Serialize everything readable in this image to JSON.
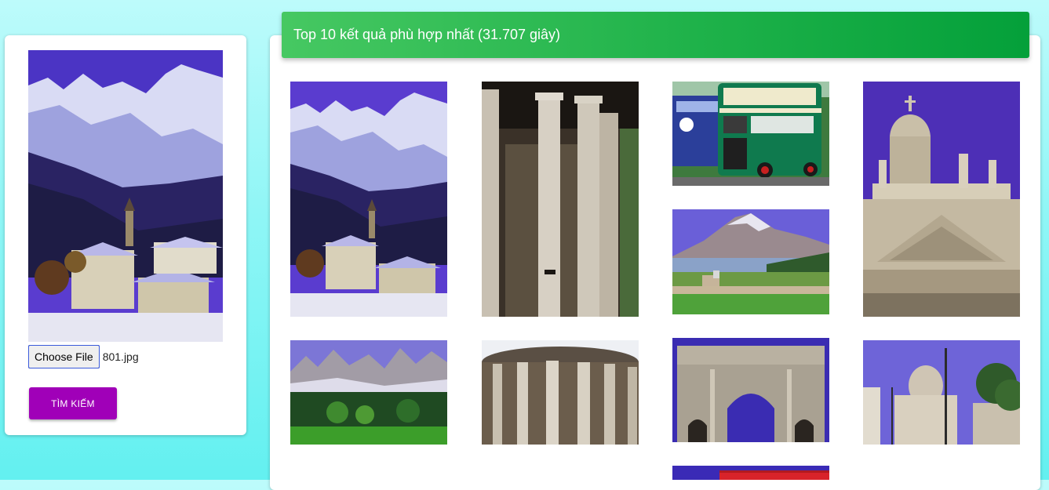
{
  "search_form": {
    "query_image_alt": "Snowy mountains above an alpine village",
    "choose_file_label": "Choose File",
    "file_name": "801.jpg",
    "search_button_label": "TÌM KIẾM"
  },
  "results": {
    "banner_text": "Top 10 kết quả phù hợp nhất (31.707 giây)",
    "items": [
      {
        "name": "result-alpine-village",
        "subject": "alpine-village"
      },
      {
        "name": "result-ancient-columns",
        "subject": "ancient-columns"
      },
      {
        "name": "result-double-decker-buses",
        "subject": "double-decker-bus"
      },
      {
        "name": "result-basilica-facade",
        "subject": "basilica-facade"
      },
      {
        "name": "result-mountain-lake",
        "subject": "mountain-lake"
      },
      {
        "name": "result-jagged-peaks-forest",
        "subject": "jagged-peaks"
      },
      {
        "name": "result-round-temple",
        "subject": "round-temple"
      },
      {
        "name": "result-triumphal-arch",
        "subject": "triumphal-arch"
      },
      {
        "name": "result-st-peters-street",
        "subject": "st-peters-street"
      },
      {
        "name": "result-red-bus-partial",
        "subject": "red-bus"
      }
    ]
  },
  "colors": {
    "page_background": "#8ff6f6",
    "banner_green": "#1fb24a",
    "search_button": "#a000b8"
  }
}
